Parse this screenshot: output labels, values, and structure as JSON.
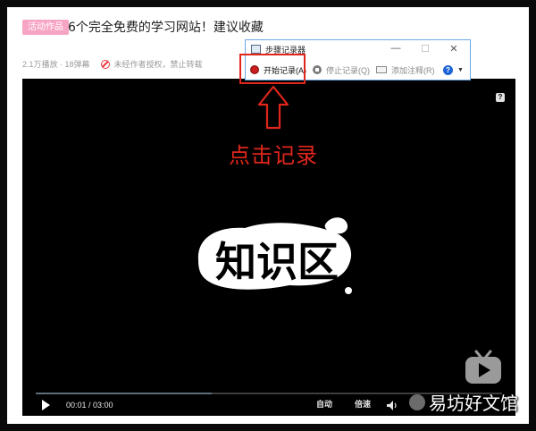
{
  "header": {
    "tag": "活动作品",
    "title": "6个完全免费的学习网站！建议收藏",
    "stats": "2.1万播放 · 18弹幕",
    "notice": "未经作者授权，禁止转载"
  },
  "recorder": {
    "title": "步骤记录器",
    "start": "开始记录(A)",
    "stop": "停止记录(Q)",
    "note": "添加注释(R)",
    "help": "?",
    "minimize": "—",
    "maximize": "☐",
    "close": "✕",
    "caret": "▼"
  },
  "annotation": "点击记录",
  "logo_text": "知识区",
  "player": {
    "help_badge": "?",
    "time": "00:01 / 03:00",
    "quality": "自动",
    "speed": "倍速",
    "progress": 0.377
  },
  "watermark": "易坊好文馆",
  "colors": {
    "accent_red": "#e1261c",
    "tag_pink": "#f7a5c4",
    "link_blue": "#6aa8e8"
  }
}
